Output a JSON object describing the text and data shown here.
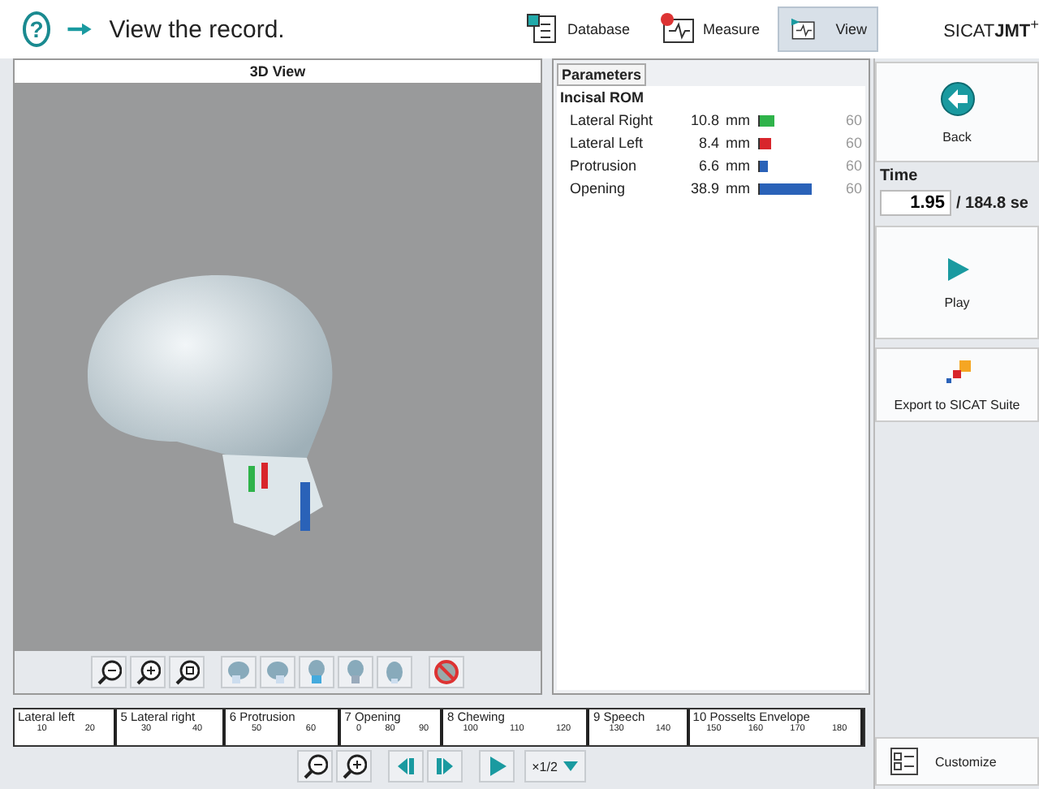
{
  "header": {
    "help": "?",
    "instruction": "View the record.",
    "modes": [
      {
        "kind": "database",
        "label": "Database",
        "selected": false
      },
      {
        "kind": "measure",
        "label": "Measure",
        "selected": false
      },
      {
        "kind": "view",
        "label": "View",
        "selected": true
      }
    ],
    "logo": "SICAT**JMT**$^{+}$"
  },
  "view3d": {
    "title": "3D View",
    "tools": [
      {
        "kind": "zoom-out"
      },
      {
        "kind": "zoom-in"
      },
      {
        "kind": "zoom-fit"
      },
      {
        "kind": "skull-left"
      },
      {
        "kind": "skull-right"
      },
      {
        "kind": "skull-front"
      },
      {
        "kind": "skull-back"
      },
      {
        "kind": "skull-top"
      },
      {
        "kind": "hide"
      }
    ]
  },
  "parameters": {
    "tab": "Parameters",
    "section": "Incisal ROM",
    "rows": [
      {
        "name": "Lateral Right",
        "value": "10.8",
        "unit": "mm",
        "level": 0.18,
        "color": "#2fb34a",
        "max": "60"
      },
      {
        "name": "Lateral Left",
        "value": "8.4",
        "unit": "mm",
        "level": 0.14,
        "color": "#d8262c",
        "max": "60"
      },
      {
        "name": "Protrusion",
        "value": "6.6",
        "unit": "mm",
        "level": 0.11,
        "color": "#2a62b8",
        "max": "60"
      },
      {
        "name": "Opening",
        "value": "38.9",
        "unit": "mm",
        "level": 0.65,
        "color": "#2a62b8",
        "max": "60"
      }
    ]
  },
  "timeline": {
    "segments": [
      {
        "label": "Lateral left",
        "ticks": [
          "10",
          "20"
        ]
      },
      {
        "label": "5 Lateral right",
        "ticks": [
          "30",
          "40"
        ]
      },
      {
        "label": "6 Protrusion",
        "ticks": [
          "50",
          "60"
        ]
      },
      {
        "label": "7 Opening",
        "ticks": [
          "0",
          "80",
          "90"
        ]
      },
      {
        "label": "8 Chewing",
        "ticks": [
          "100",
          "110",
          "120"
        ]
      },
      {
        "label": "9 Speech",
        "ticks": [
          "130",
          "140"
        ]
      },
      {
        "label": "10 Posselts Envelope",
        "ticks": [
          "150",
          "160",
          "170",
          "180"
        ]
      }
    ],
    "controls": [
      {
        "kind": "zoom-out"
      },
      {
        "kind": "zoom-in"
      },
      {
        "kind": "step-back"
      },
      {
        "kind": "step-forward"
      },
      {
        "kind": "play"
      }
    ],
    "speed": "×1/2"
  },
  "sidebar": {
    "back": "Back",
    "time_label": "Time",
    "time_value": "1.95",
    "time_total": "/ 184.8 se",
    "play": "Play",
    "export": "Export to SICAT Suite",
    "customize": "Customize"
  }
}
